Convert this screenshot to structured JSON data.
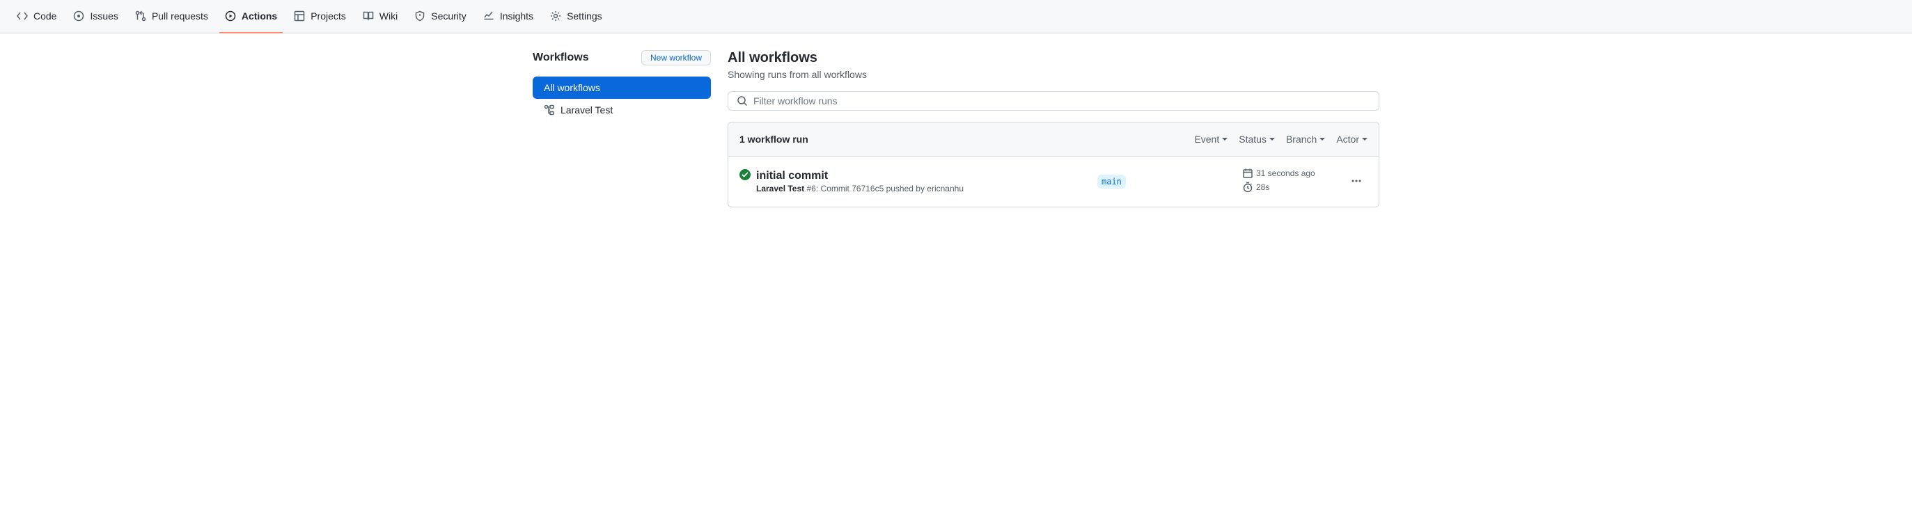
{
  "nav": {
    "tabs": [
      {
        "label": "Code"
      },
      {
        "label": "Issues"
      },
      {
        "label": "Pull requests"
      },
      {
        "label": "Actions"
      },
      {
        "label": "Projects"
      },
      {
        "label": "Wiki"
      },
      {
        "label": "Security"
      },
      {
        "label": "Insights"
      },
      {
        "label": "Settings"
      }
    ]
  },
  "sidebar": {
    "title": "Workflows",
    "new_workflow_label": "New workflow",
    "items": [
      {
        "label": "All workflows"
      },
      {
        "label": "Laravel Test"
      }
    ]
  },
  "main": {
    "title": "All workflows",
    "subtitle": "Showing runs from all workflows",
    "search_placeholder": "Filter workflow runs"
  },
  "runs": {
    "count_label": "1 workflow run",
    "filters": {
      "event": "Event",
      "status": "Status",
      "branch": "Branch",
      "actor": "Actor"
    },
    "items": [
      {
        "title": "initial commit",
        "workflow": "Laravel Test",
        "run_number": "#6",
        "meta_rest": ": Commit 76716c5 pushed by ericnanhu",
        "branch": "main",
        "time_ago": "31 seconds ago",
        "duration": "28s"
      }
    ]
  }
}
